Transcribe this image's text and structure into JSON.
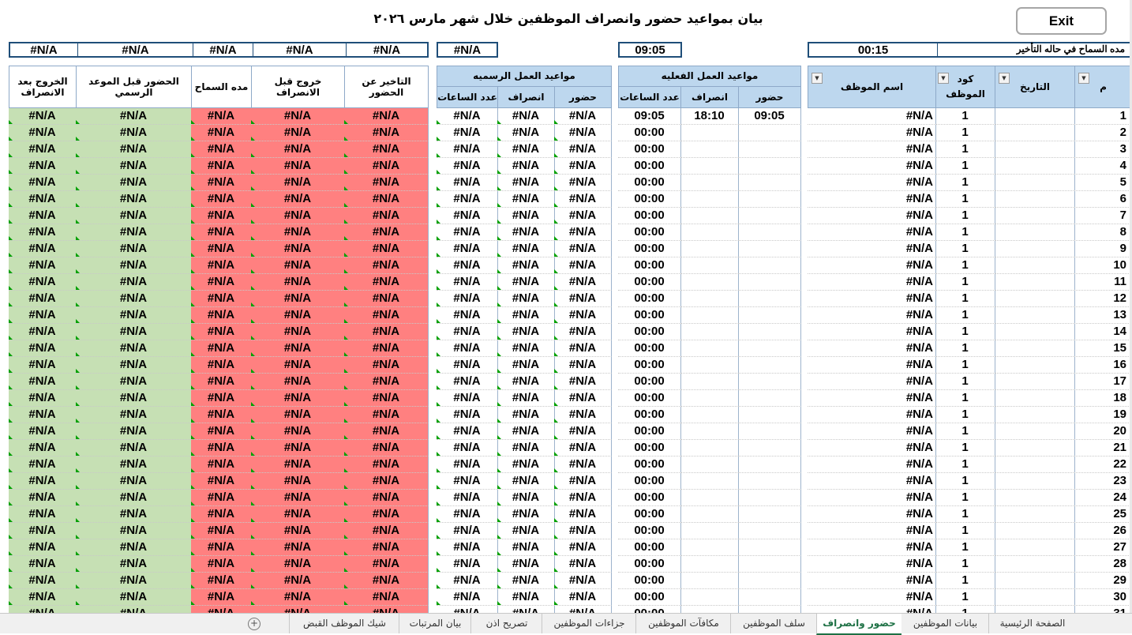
{
  "title": "بيان بمواعيد حضور وانصراف الموظفين خلال شهر مارس ٢٠٢٦",
  "exit_label": "Exit",
  "top_row": {
    "grace_label": "مده السماح في حاله التأخير",
    "grace_value": "00:15",
    "actual_hours_total": "09:05",
    "official_hours_total": "#N/A",
    "summary_values": [
      "#N/A",
      "#N/A",
      "#N/A",
      "#N/A",
      "#N/A"
    ]
  },
  "headers": {
    "num": "م",
    "date": "التاريخ",
    "emp_code": "كود الموظف",
    "emp_name": "اسم الموظف",
    "actual_group": "مواعيد العمل الفعليه",
    "official_group": "مواعيد العمل الرسميه",
    "attend": "حضور",
    "leave": "انصراف",
    "hours": "عدد الساعات",
    "late": "التاخير عن الحضور",
    "early_exit": "خروج قبل الانصراف",
    "grace": "مده السماح",
    "early_attend": "الحضور قبل الموعد الرسمي",
    "late_exit": "الخروج بعد الانصراف"
  },
  "na": "#N/A",
  "first_row": {
    "attend": "09:05",
    "leave": "18:10",
    "hours": "09:05"
  },
  "default_hours": "00:00",
  "emp_code_value": "1",
  "last_partial_hours": "00:00",
  "tabs": [
    "الصفحة الرئيسية",
    "بيانات الموظفين",
    "حضور وانصراف",
    "سلف الموظفين",
    "مكافآت الموظفين",
    "جزاءات الموظفين",
    "تصريح اذن",
    "بيان المرتبات",
    "شيك الموظف القبض"
  ],
  "active_tab": "حضور وانصراف"
}
